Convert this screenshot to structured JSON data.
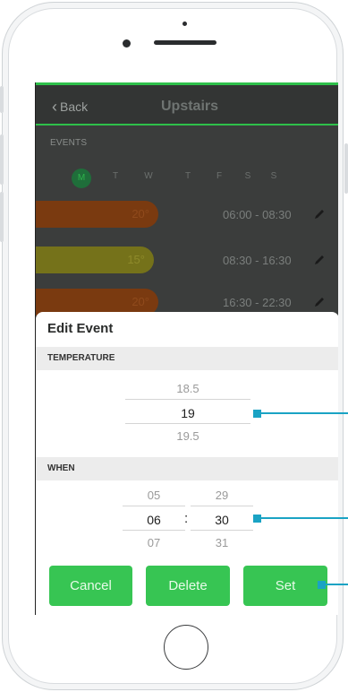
{
  "nav": {
    "back_label": "Back",
    "title": "Upstairs"
  },
  "events_label": "EVENTS",
  "days": [
    {
      "label": "M",
      "active": true
    },
    {
      "label": "T",
      "active": false
    },
    {
      "label": "W",
      "active": false
    },
    {
      "label": "T",
      "active": false
    },
    {
      "label": "F",
      "active": false
    },
    {
      "label": "S",
      "active": false
    },
    {
      "label": "S",
      "active": false
    }
  ],
  "events": [
    {
      "temp": "20°",
      "time": "06:00 - 08:30",
      "color": "orange"
    },
    {
      "temp": "15°",
      "time": "08:30 - 16:30",
      "color": "yellow"
    },
    {
      "temp": "20°",
      "time": "16:30 - 22:30",
      "color": "orange"
    }
  ],
  "edit_event": {
    "title": "Edit Event",
    "temperature_label": "TEMPERATURE",
    "temperature_picker": {
      "above": "18.5",
      "selected": "19",
      "below": "19.5"
    },
    "when_label": "WHEN",
    "hour_picker": {
      "above": "05",
      "selected": "06",
      "below": "07"
    },
    "separator": ":",
    "minute_picker": {
      "above": "29",
      "selected": "30",
      "below": "31"
    },
    "buttons": {
      "cancel": "Cancel",
      "delete": "Delete",
      "set": "Set"
    }
  },
  "colors": {
    "accent_green": "#37c553",
    "callout": "#1aa3c4",
    "event_orange": "#7a3a10",
    "event_yellow": "#75721a"
  }
}
